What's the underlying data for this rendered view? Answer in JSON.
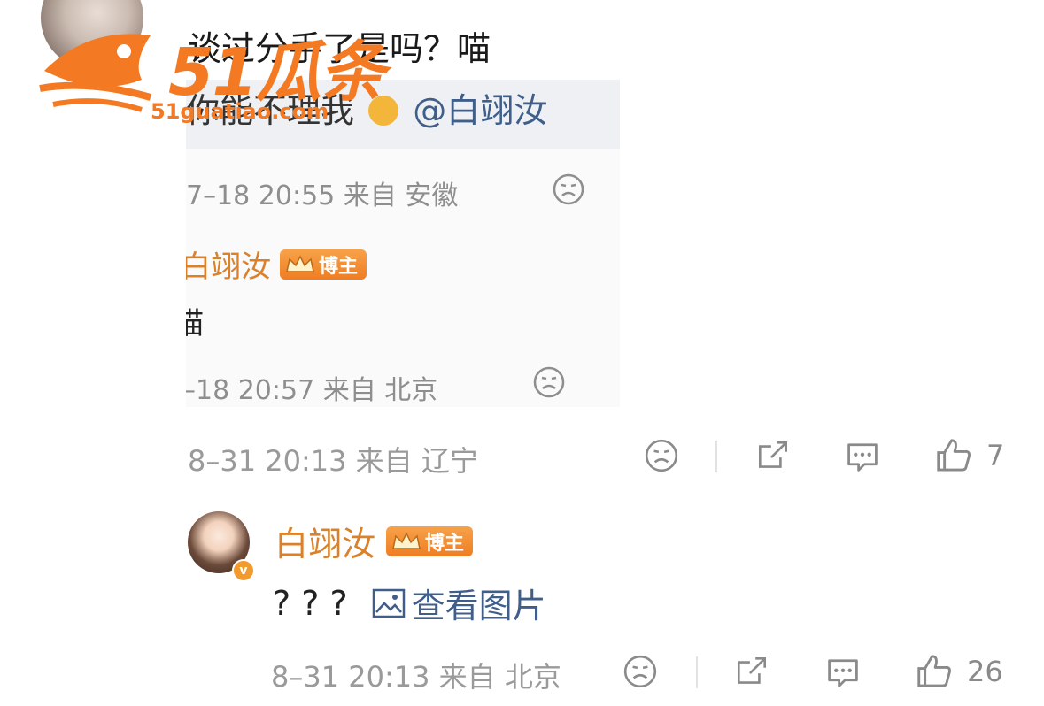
{
  "top_comment": {
    "text": "谈过分手了是吗？喵"
  },
  "watermark": {
    "brand": "51瓜条",
    "url": "51guatiao.com"
  },
  "embedded": {
    "mention_prefix": "你能不理我",
    "mention": "@白翊汝",
    "meta1": "7–18 20:55  来自 安徽",
    "author": "白翊汝",
    "badge": "博主",
    "body": "喵",
    "meta2": "–18 20:57  来自 北京"
  },
  "comment_footer": {
    "meta": "8–31 20:13  来自 辽宁",
    "like_count": "7"
  },
  "reply": {
    "author": "白翊汝",
    "badge": "博主",
    "verified": "v",
    "text": "? ? ?",
    "view_image": "查看图片",
    "meta": "8–31 20:13  来自 北京",
    "like_count": "26"
  },
  "colors": {
    "author": "#d9822b",
    "link": "#3f5e8a",
    "meta": "#9a9a9a",
    "watermark": "#f37a22"
  },
  "icons": [
    "sad-face-icon",
    "share-icon",
    "comment-icon",
    "thumbs-up-icon",
    "image-icon",
    "crown-icon"
  ]
}
